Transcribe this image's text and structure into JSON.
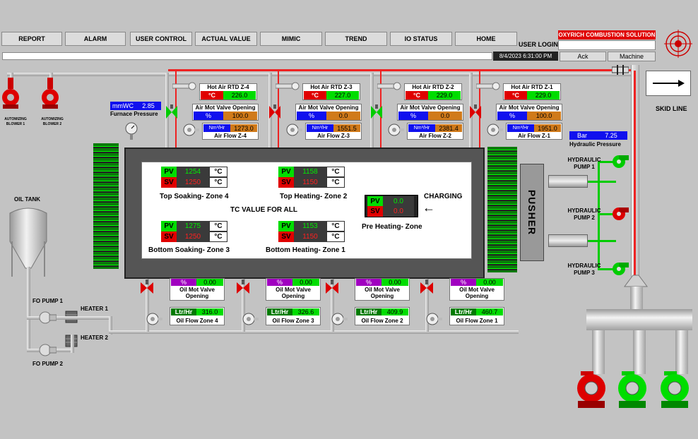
{
  "nav": {
    "report": "REPORT",
    "alarm": "ALARM",
    "user_control": "USER CONTROL",
    "actual_value": "ACTUAL VALUE",
    "mimic": "MIMIC",
    "trend": "TREND",
    "io_status": "IO STATUS",
    "home": "HOME"
  },
  "header": {
    "user_login": "USER LOGIN",
    "company": "OXYRICH COMBUSTION SOLUTION",
    "datetime": "8/4/2023 6:31:00 PM",
    "ack": "Ack",
    "machine": "Machine"
  },
  "blowers": [
    {
      "label": "AUTOMIZING\nBLOWER 1"
    },
    {
      "label": "AUTOMIZING\nBLOWER 2"
    }
  ],
  "furnace_pressure": {
    "unit": "mmWC",
    "value": "2.85",
    "label": "Furnace Pressure"
  },
  "hydraulic_pressure": {
    "unit": "Bar",
    "value": "7.25",
    "label": "Hydraulic Pressure"
  },
  "skid_line": "SKID LINE",
  "top_zones": [
    {
      "rtd_title": "Hot Air RTD Z-4",
      "rtd_unit": "°C",
      "rtd_value": "226.0",
      "valve_title": "Air Mot Valve Opening",
      "valve_unit": "%",
      "valve_value": "100.0",
      "flow_unit": "Nm³/Hr",
      "flow_value": "1273.0",
      "flow_label": "Air Flow Z-4"
    },
    {
      "rtd_title": "Hot Air RTD Z-3",
      "rtd_unit": "°C",
      "rtd_value": "227.0",
      "valve_title": "Air Mot Valve Opening",
      "valve_unit": "%",
      "valve_value": "0.0",
      "flow_unit": "Nm³/Hr",
      "flow_value": "1551.5",
      "flow_label": "Air Flow Z-3"
    },
    {
      "rtd_title": "Hot Air RTD Z-2",
      "rtd_unit": "°C",
      "rtd_value": "229.0",
      "valve_title": "Air Mot Valve Opening",
      "valve_unit": "%",
      "valve_value": "0.0",
      "flow_unit": "Nm³/Hr",
      "flow_value": "2381.4",
      "flow_label": "Air Flow Z-2"
    },
    {
      "rtd_title": "Hot Air RTD Z-1",
      "rtd_unit": "°C",
      "rtd_value": "229.0",
      "valve_title": "Air Mot Valve Opening",
      "valve_unit": "%",
      "valve_value": "100.0",
      "flow_unit": "Nm³/Hr",
      "flow_value": "1951.0",
      "flow_label": "Air Flow Z-1"
    }
  ],
  "furnace": {
    "tc_title": "TC VALUE FOR ALL",
    "pv": "PV",
    "sv": "SV",
    "unit": "°C",
    "zones": [
      {
        "name": "Top Soaking- Zone 4",
        "pv": "1254",
        "sv": "1250"
      },
      {
        "name": "Top Heating- Zone 2",
        "pv": "1158",
        "sv": "1150"
      },
      {
        "name": "Bottom Soaking- Zone 3",
        "pv": "1275",
        "sv": "1250"
      },
      {
        "name": "Bottom Heating- Zone 1",
        "pv": "1153",
        "sv": "1150"
      }
    ],
    "preheat": {
      "name": "Pre Heating- Zone",
      "pv": "0.0",
      "sv": "0.0"
    },
    "charging": "CHARGING",
    "charging_arrow": "←"
  },
  "pusher": "PUSHER",
  "pumps": [
    "HYDRAULIC\nPUMP 1",
    "HYDRAULIC\nPUMP 2",
    "HYDRAULIC\nPUMP 3"
  ],
  "oil_tank": "OIL TANK",
  "fo_pump_1": "FO PUMP 1",
  "fo_pump_2": "FO PUMP 2",
  "heater_1": "HEATER 1",
  "heater_2": "HEATER 2",
  "oil_zones": [
    {
      "valve_unit": "%",
      "valve_value": "0.00",
      "valve_title": "Oil Mot Valve\nOpening",
      "flow_unit": "Ltr/Hr",
      "flow_value": "316.0",
      "flow_label": "Oil Flow Zone 4"
    },
    {
      "valve_unit": "%",
      "valve_value": "0.00",
      "valve_title": "Oil Mot Valve\nOpening",
      "flow_unit": "Ltr/Hr",
      "flow_value": "326.6",
      "flow_label": "Oil Flow Zone 3"
    },
    {
      "valve_unit": "%",
      "valve_value": "0.00",
      "valve_title": "Oil Mot Valve\nOpening",
      "flow_unit": "Ltr/Hr",
      "flow_value": "409.9",
      "flow_label": "Oil Flow Zone 2"
    },
    {
      "valve_unit": "%",
      "valve_value": "0.00",
      "valve_title": "Oil Mot Valve\nOpening",
      "flow_unit": "Ltr/Hr",
      "flow_value": "460.7",
      "flow_label": "Oil Flow Zone 1"
    }
  ],
  "colors": {
    "bg": "#c3c3c3",
    "green": "#00dd00",
    "red": "#e00000",
    "blue": "#1010ee",
    "purple": "#a000c0",
    "orange": "#d07a1a",
    "darkgreen": "#007a00"
  }
}
